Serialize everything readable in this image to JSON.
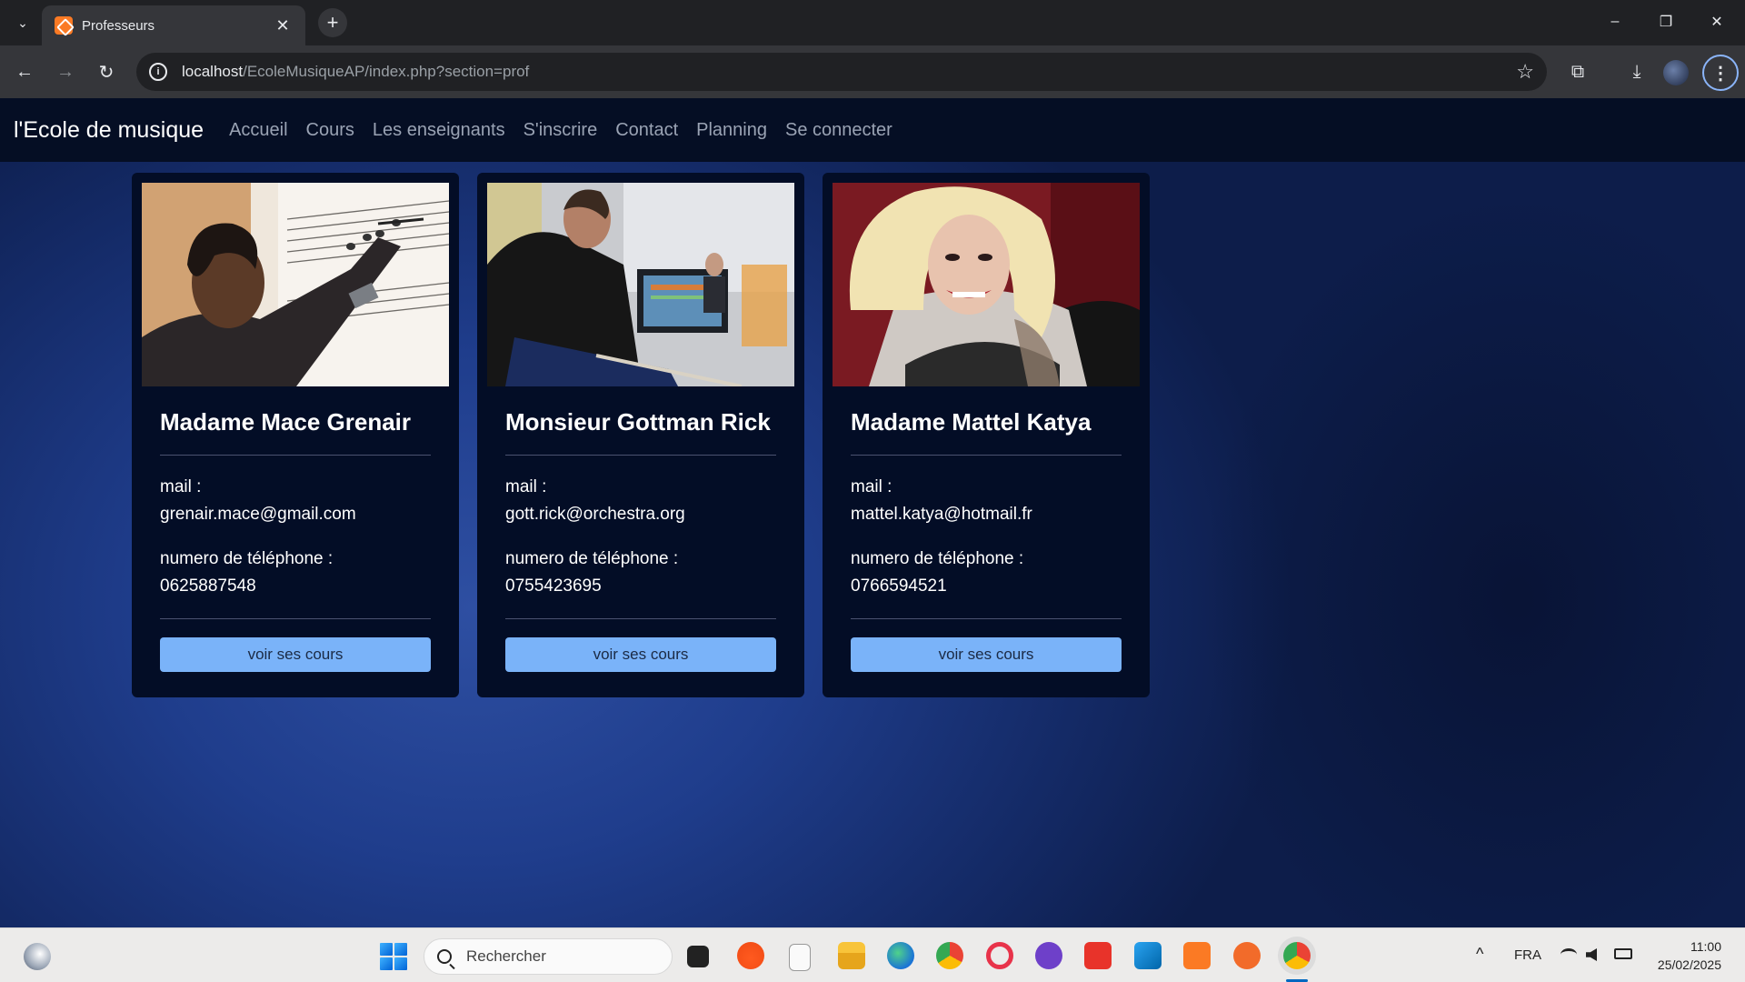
{
  "browser": {
    "tab_title": "Professeurs",
    "tab_list_icon": "⌄",
    "close_icon": "✕",
    "new_tab_icon": "+",
    "window": {
      "minimize": "–",
      "restore": "❐",
      "close": "✕"
    },
    "url_host": "localhost",
    "url_path": "/EcoleMusiqueAP/index.php?section=prof",
    "back_icon": "←",
    "forward_icon": "→",
    "reload_icon": "↻",
    "info_icon": "i",
    "star_icon": "☆",
    "extensions_icon": "⧉",
    "download_icon": "⤓",
    "menu_icon": "⋮"
  },
  "navbar": {
    "brand": "l'Ecole de musique",
    "links": [
      "Accueil",
      "Cours",
      "Les enseignants",
      "S'inscrire",
      "Contact",
      "Planning",
      "Se connecter"
    ]
  },
  "teachers": [
    {
      "name": "Madame Mace Grenair",
      "mail_label": "mail :",
      "mail": "grenair.mace@gmail.com",
      "phone_label": "numero de téléphone :",
      "phone": "0625887548",
      "button": "voir ses cours"
    },
    {
      "name": "Monsieur Gottman Rick",
      "mail_label": "mail :",
      "mail": "gott.rick@orchestra.org",
      "phone_label": "numero de téléphone :",
      "phone": "0755423695",
      "button": "voir ses cours"
    },
    {
      "name": "Madame Mattel Katya",
      "mail_label": "mail :",
      "mail": "mattel.katya@hotmail.fr",
      "phone_label": "numero de téléphone :",
      "phone": "0766594521",
      "button": "voir ses cours"
    }
  ],
  "taskbar": {
    "search_placeholder": "Rechercher",
    "language": "FRA",
    "chevron_icon": "^",
    "time": "11:00",
    "date": "25/02/2025"
  },
  "colors": {
    "button": "#7ab3f9",
    "card_bg": "#030d26",
    "navbar_bg": "#050e24"
  }
}
